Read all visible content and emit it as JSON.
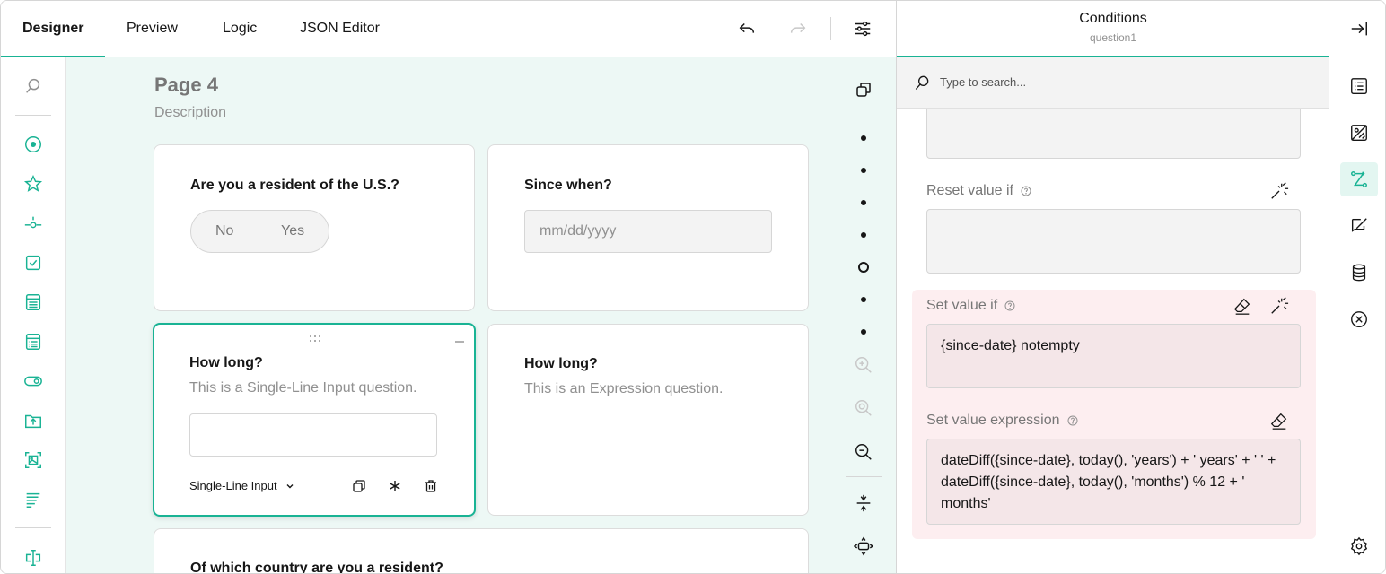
{
  "tabs": [
    {
      "label": "Designer",
      "active": true
    },
    {
      "label": "Preview",
      "active": false
    },
    {
      "label": "Logic",
      "active": false
    },
    {
      "label": "JSON Editor",
      "active": false
    }
  ],
  "toolbar": {
    "undo_icon": "undo-icon",
    "redo_icon": "redo-icon",
    "settings_icon": "sliders-icon"
  },
  "toolbox": {
    "icons": [
      "search-icon",
      "radio-icon",
      "star-icon",
      "slider-icon",
      "checkbox-icon",
      "dropdown-icon",
      "matrix-icon",
      "toggle-icon",
      "file-upload-icon",
      "image-icon",
      "text-icon",
      "text-cursor-icon"
    ]
  },
  "page": {
    "title": "Page 4",
    "description": "Description",
    "questions": [
      {
        "title": "Are you a resident of the U.S.?",
        "options": [
          "No",
          "Yes"
        ]
      },
      {
        "title": "Since when?",
        "placeholder": "mm/dd/yyyy"
      },
      {
        "title": "How long?",
        "description": "This is a Single-Line Input question.",
        "type_label": "Single-Line Input"
      },
      {
        "title": "How long?",
        "description": "This is an Expression question."
      },
      {
        "title": "Of which country are you a resident?"
      }
    ]
  },
  "property_grid": {
    "title": "Conditions",
    "subtitle": "question1",
    "search_placeholder": "Type to search...",
    "reset_value_label": "Reset value if",
    "set_value_label": "Set value if",
    "set_value_text": "{since-date} notempty",
    "set_value_expr_label": "Set value expression",
    "set_value_expr_text": "dateDiff({since-date}, today(), 'years') + ' years' + ' ' + dateDiff({since-date}, today(), 'months') % 12 + ' months'"
  },
  "colors": {
    "accent": "#19b394",
    "canvas_bg": "#edf8f5",
    "highlight_bg": "#fdeef0"
  }
}
